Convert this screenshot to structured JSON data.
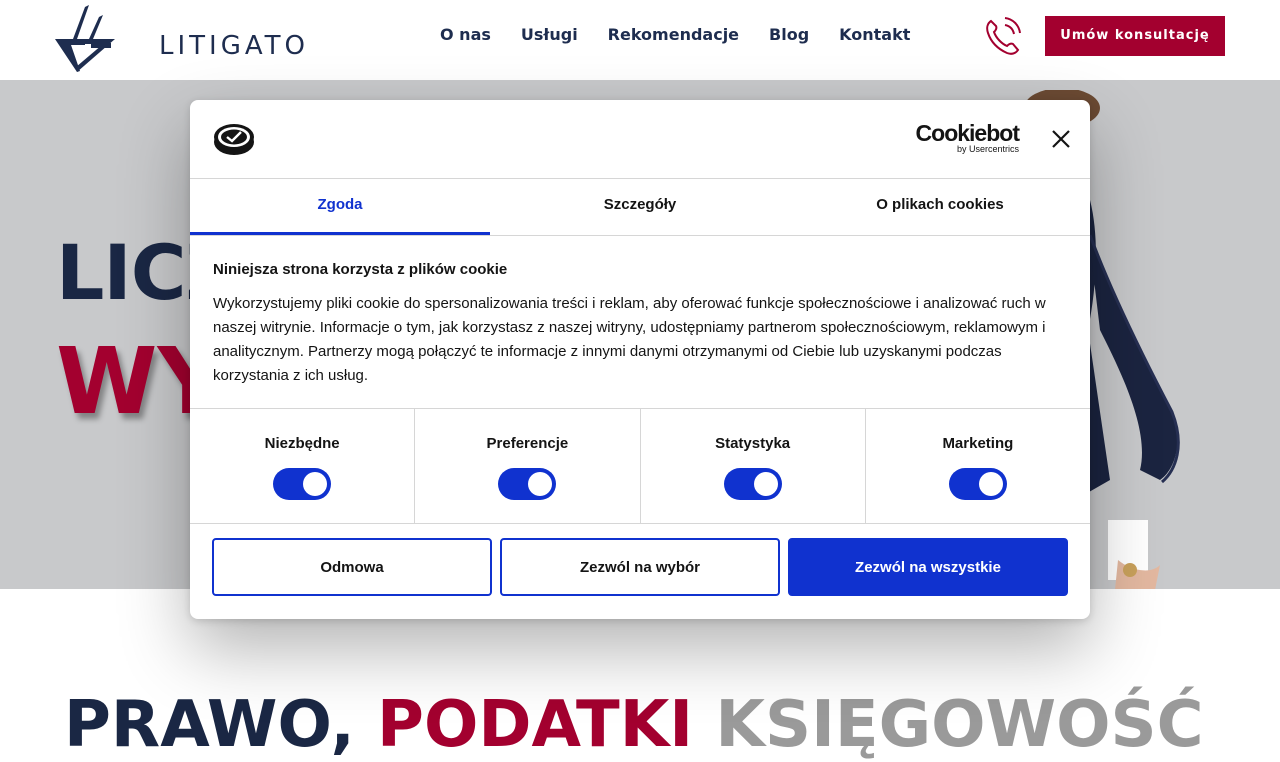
{
  "header": {
    "logo_text": "LITIGATO",
    "nav": [
      "O nas",
      "Usługi",
      "Rekomendacje",
      "Blog",
      "Kontakt"
    ],
    "cta_label": "Umów konsultację"
  },
  "hero": {
    "line1": "LICZ",
    "line2": "WY"
  },
  "teaser": {
    "part1": "PRAWO, ",
    "part2": "PODATKI ",
    "part3": "KSIĘGOWOŚĆ"
  },
  "cookie_dialog": {
    "brand": "Cookiebot",
    "brand_sub": "by Usercentrics",
    "tabs": [
      "Zgoda",
      "Szczegóły",
      "O plikach cookies"
    ],
    "active_tab": "Zgoda",
    "heading": "Niniejsza strona korzysta z plików cookie",
    "body": "Wykorzystujemy pliki cookie do spersonalizowania treści i reklam, aby oferować funkcje społecznościowe i analizować ruch w naszej witrynie. Informacje o tym, jak korzystasz z naszej witryny, udostępniamy partnerom społecznościowym, reklamowym i analitycznym. Partnerzy mogą połączyć te informacje z innymi danymi otrzymanymi od Ciebie lub uzyskanymi podczas korzystania z ich usług.",
    "toggles": [
      {
        "label": "Niezbędne",
        "on": true
      },
      {
        "label": "Preferencje",
        "on": true
      },
      {
        "label": "Statystyka",
        "on": true
      },
      {
        "label": "Marketing",
        "on": true
      }
    ],
    "buttons": {
      "deny": "Odmowa",
      "allow_selection": "Zezwól na wybór",
      "allow_all": "Zezwól na wszystkie"
    }
  },
  "colors": {
    "brand_navy": "#1e2d4f",
    "brand_red": "#a3002f",
    "cookiebot_blue": "#1032cf",
    "hero_bg": "#c8c9cb"
  }
}
